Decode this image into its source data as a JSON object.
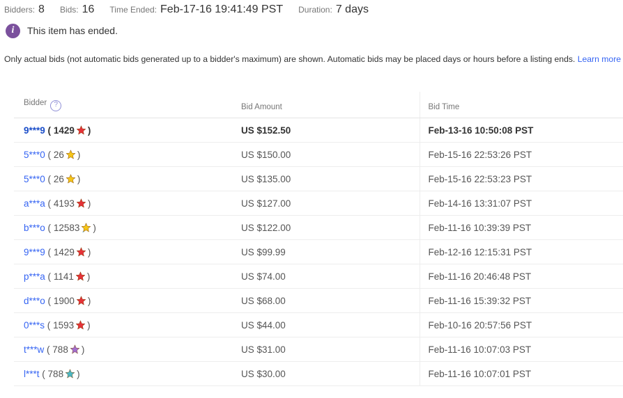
{
  "summary": {
    "bidders_label": "Bidders:",
    "bidders_value": "8",
    "bids_label": "Bids:",
    "bids_value": "16",
    "time_ended_label": "Time Ended:",
    "time_ended_value": "Feb-17-16 19:41:49 PST",
    "duration_label": "Duration:",
    "duration_value": "7 days"
  },
  "notice": {
    "icon": "info-icon",
    "text": "This item has ended."
  },
  "disclaimer": {
    "text": "Only actual bids (not automatic bids generated up to a bidder's maximum) are shown. Automatic bids may be placed days or hours before a listing ends.",
    "link_label": "Learn more"
  },
  "table": {
    "headers": {
      "bidder": "Bidder",
      "bidder_help": "?",
      "amount": "Bid Amount",
      "time": "Bid Time"
    },
    "rows": [
      {
        "bidder": "9***9",
        "open": "(",
        "feedback": "1429",
        "star": "red-star",
        "close": ")",
        "amount": "US $152.50",
        "time": "Feb-13-16 10:50:08 PST",
        "winner": true
      },
      {
        "bidder": "5***0",
        "open": "(",
        "feedback": "26",
        "star": "yellow-star",
        "close": ")",
        "amount": "US $150.00",
        "time": "Feb-15-16 22:53:26 PST",
        "winner": false
      },
      {
        "bidder": "5***0",
        "open": "(",
        "feedback": "26",
        "star": "yellow-star",
        "close": ")",
        "amount": "US $135.00",
        "time": "Feb-15-16 22:53:23 PST",
        "winner": false
      },
      {
        "bidder": "a***a",
        "open": "(",
        "feedback": "4193",
        "star": "red-star",
        "close": ")",
        "amount": "US $127.00",
        "time": "Feb-14-16 13:31:07 PST",
        "winner": false
      },
      {
        "bidder": "b***o",
        "open": "(",
        "feedback": "12583",
        "star": "yellow-shooting-star",
        "close": ")",
        "amount": "US $122.00",
        "time": "Feb-11-16 10:39:39 PST",
        "winner": false
      },
      {
        "bidder": "9***9",
        "open": "(",
        "feedback": "1429",
        "star": "red-star",
        "close": ")",
        "amount": "US $99.99",
        "time": "Feb-12-16 12:15:31 PST",
        "winner": false
      },
      {
        "bidder": "p***a",
        "open": "(",
        "feedback": "1141",
        "star": "red-star",
        "close": ")",
        "amount": "US $74.00",
        "time": "Feb-11-16 20:46:48 PST",
        "winner": false
      },
      {
        "bidder": "d***o",
        "open": "(",
        "feedback": "1900",
        "star": "red-star",
        "close": ")",
        "amount": "US $68.00",
        "time": "Feb-11-16 15:39:32 PST",
        "winner": false
      },
      {
        "bidder": "0***s",
        "open": "(",
        "feedback": "1593",
        "star": "red-star",
        "close": ")",
        "amount": "US $44.00",
        "time": "Feb-10-16 20:57:56 PST",
        "winner": false
      },
      {
        "bidder": "t***w",
        "open": "(",
        "feedback": "788",
        "star": "purple-star",
        "close": ")",
        "amount": "US $31.00",
        "time": "Feb-11-16 10:07:03 PST",
        "winner": false
      },
      {
        "bidder": "l***t",
        "open": "(",
        "feedback": "788",
        "star": "teal-star",
        "close": ")",
        "amount": "US $30.00",
        "time": "Feb-11-16 10:07:01 PST",
        "winner": false
      }
    ]
  },
  "colors": {
    "link_blue": "#3665f3",
    "info_purple": "#7B519D",
    "red_star": "#e53238",
    "yellow_star": "#f5c518",
    "purple_star": "#a26ed0",
    "teal_star": "#4cb8c4",
    "muted_text": "#767676"
  }
}
